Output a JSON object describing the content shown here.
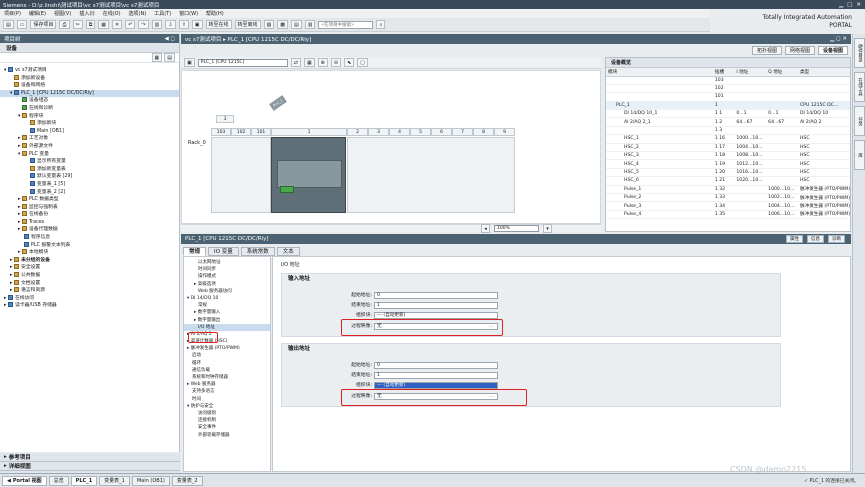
{
  "window": {
    "title": "Siemens - D:\\z.linshi\\测试项目\\vc s7测试项目\\vc s7测试项目"
  },
  "menu": {
    "items": [
      "项目(P)",
      "编辑(E)",
      "视图(V)",
      "插入(I)",
      "在线(O)",
      "选项(N)",
      "工具(T)",
      "窗口(W)",
      "帮助(H)"
    ]
  },
  "toolbar": {
    "save_label": "保存项目",
    "online_label": "转至在线",
    "offline_label": "转至离线",
    "search_placeholder": "<在项目中搜索>"
  },
  "brand": {
    "line1": "Totally Integrated Automation",
    "line2": "PORTAL"
  },
  "project_tree": {
    "header": "项目树",
    "devices_tab": "设备",
    "items": [
      "vc s7测试项目",
      "添加新设备",
      "设备和网络",
      "PLC_1 [CPU 1215C DC/DC/Rly]",
      "设备组态",
      "在线和诊断",
      "程序块",
      "添加新块",
      "Main [OB1]",
      "工艺对象",
      "外部源文件",
      "PLC 变量",
      "显示所有变量",
      "添加新变量表",
      "默认变量表 [29]",
      "变量表_1 [5]",
      "变量表_2 [2]",
      "PLC 数据类型",
      "监控与强制表",
      "在线备份",
      "Traces",
      "设备代理数据",
      "程序信息",
      "PLC 报警文本列表",
      "本地模块",
      "未分组的设备",
      "安全设置",
      "公共数据",
      "文档设置",
      "语言和资源",
      "在线访问",
      "读卡器/USB 存储器"
    ],
    "selected_index": 3
  },
  "left_bottom": {
    "ref_projects": "参考项目",
    "details_view": "详细视图"
  },
  "editor": {
    "breadcrumb": "vc s7测试项目 ▸ PLC_1 [CPU 1215C DC/DC/Rly]",
    "view_tabs": [
      "拓扑视图",
      "网络视图",
      "设备视图"
    ],
    "device_select": "PLC_1 [CPU 1215C]",
    "zoom": "100%",
    "rack_label": "Rack_0",
    "slot_numbers": [
      "103",
      "102",
      "101",
      "1",
      "2",
      "3",
      "4",
      "5",
      "6",
      "7",
      "8",
      "9"
    ],
    "slot_top": "3"
  },
  "overview": {
    "tab": "设备概览",
    "columns": [
      "模块",
      "插槽",
      "I 地址",
      "Q 地址",
      "类型"
    ],
    "rows": [
      [
        "",
        "103",
        "",
        "",
        ""
      ],
      [
        "",
        "102",
        "",
        "",
        ""
      ],
      [
        "",
        "101",
        "",
        "",
        ""
      ],
      [
        "PLC_1",
        "1",
        "",
        "",
        "CPU 1215C DC..."
      ],
      [
        "DI 14/DQ 10_1",
        "1 1",
        "0...1",
        "0...1",
        "DI 14/DQ 10"
      ],
      [
        "AI 2/AQ 2_1",
        "1 2",
        "64...67",
        "64...67",
        "AI 2/AQ 2"
      ],
      [
        "",
        "1 3",
        "",
        "",
        ""
      ],
      [
        "HSC_1",
        "1 16",
        "1000...10...",
        "",
        "HSC"
      ],
      [
        "HSC_2",
        "1 17",
        "1004...10...",
        "",
        "HSC"
      ],
      [
        "HSC_3",
        "1 18",
        "1008...10...",
        "",
        "HSC"
      ],
      [
        "HSC_4",
        "1 19",
        "1012...10...",
        "",
        "HSC"
      ],
      [
        "HSC_5",
        "1 20",
        "1016...10...",
        "",
        "HSC"
      ],
      [
        "HSC_6",
        "1 21",
        "1020...10...",
        "",
        "HSC"
      ],
      [
        "Pulse_1",
        "1 32",
        "",
        "1000...10...",
        "脉冲发生器 (PTO/PWM)"
      ],
      [
        "Pulse_2",
        "1 33",
        "",
        "1002...10...",
        "脉冲发生器 (PTO/PWM)"
      ],
      [
        "Pulse_3",
        "1 34",
        "",
        "1004...10...",
        "脉冲发生器 (PTO/PWM)"
      ],
      [
        "Pulse_4",
        "1 35",
        "",
        "1006...10...",
        "脉冲发生器 (PTO/PWM)"
      ]
    ]
  },
  "properties": {
    "header": "PLC_1 [CPU 1215C DC/DC/Rly]",
    "right_tabs": [
      "属性",
      "信息",
      "诊断"
    ],
    "tabs": [
      "常规",
      "IO 变量",
      "系统常数",
      "文本"
    ],
    "nav": [
      "以太网地址",
      "时间同步",
      "操作模式",
      "高级选项",
      "Web 服务器访问",
      "DI 14/DQ 10",
      "常规",
      "数字量输入",
      "数字量输出",
      "I/O 地址",
      "AI 2/AQ 2",
      "高速计数器 (HSC)",
      "脉冲发生器 (PTO/PWM)",
      "启动",
      "循环",
      "通信负载",
      "系统和时钟存储器",
      "Web 服务器",
      "支持多语言",
      "时间",
      "防护与安全",
      "访问级别",
      "连接机制",
      "安全事件",
      "外部装载存储器"
    ],
    "nav_selected_index": 9,
    "breadcrumb": "I/O 地址",
    "input_section": {
      "title": "输入地址",
      "start_label": "起始地址:",
      "start_value": "0",
      "end_label": "结束地址:",
      "end_value": "1",
      "org_label": "组织块:",
      "org_value": "--- (自动更新)",
      "pip_label": "过程映像:",
      "pip_value": "无"
    },
    "output_section": {
      "title": "输出地址",
      "start_label": "起始地址:",
      "start_value": "0",
      "end_label": "结束地址:",
      "end_value": "1",
      "org_label": "组织块:",
      "org_value": "--- (自动更新)",
      "pip_label": "过程映像:",
      "pip_value": "无"
    }
  },
  "side_tabs": [
    "硬件目录",
    "在线工具",
    "任务",
    "库"
  ],
  "taskbar": {
    "portal": "Portal 视图",
    "items": [
      "总览",
      "PLC_1",
      "变量表_1",
      "Main (OB1)",
      "变量表_2"
    ],
    "status": "PLC_1 的连接已关闭。"
  },
  "watermark": "CSDN @damo2215"
}
